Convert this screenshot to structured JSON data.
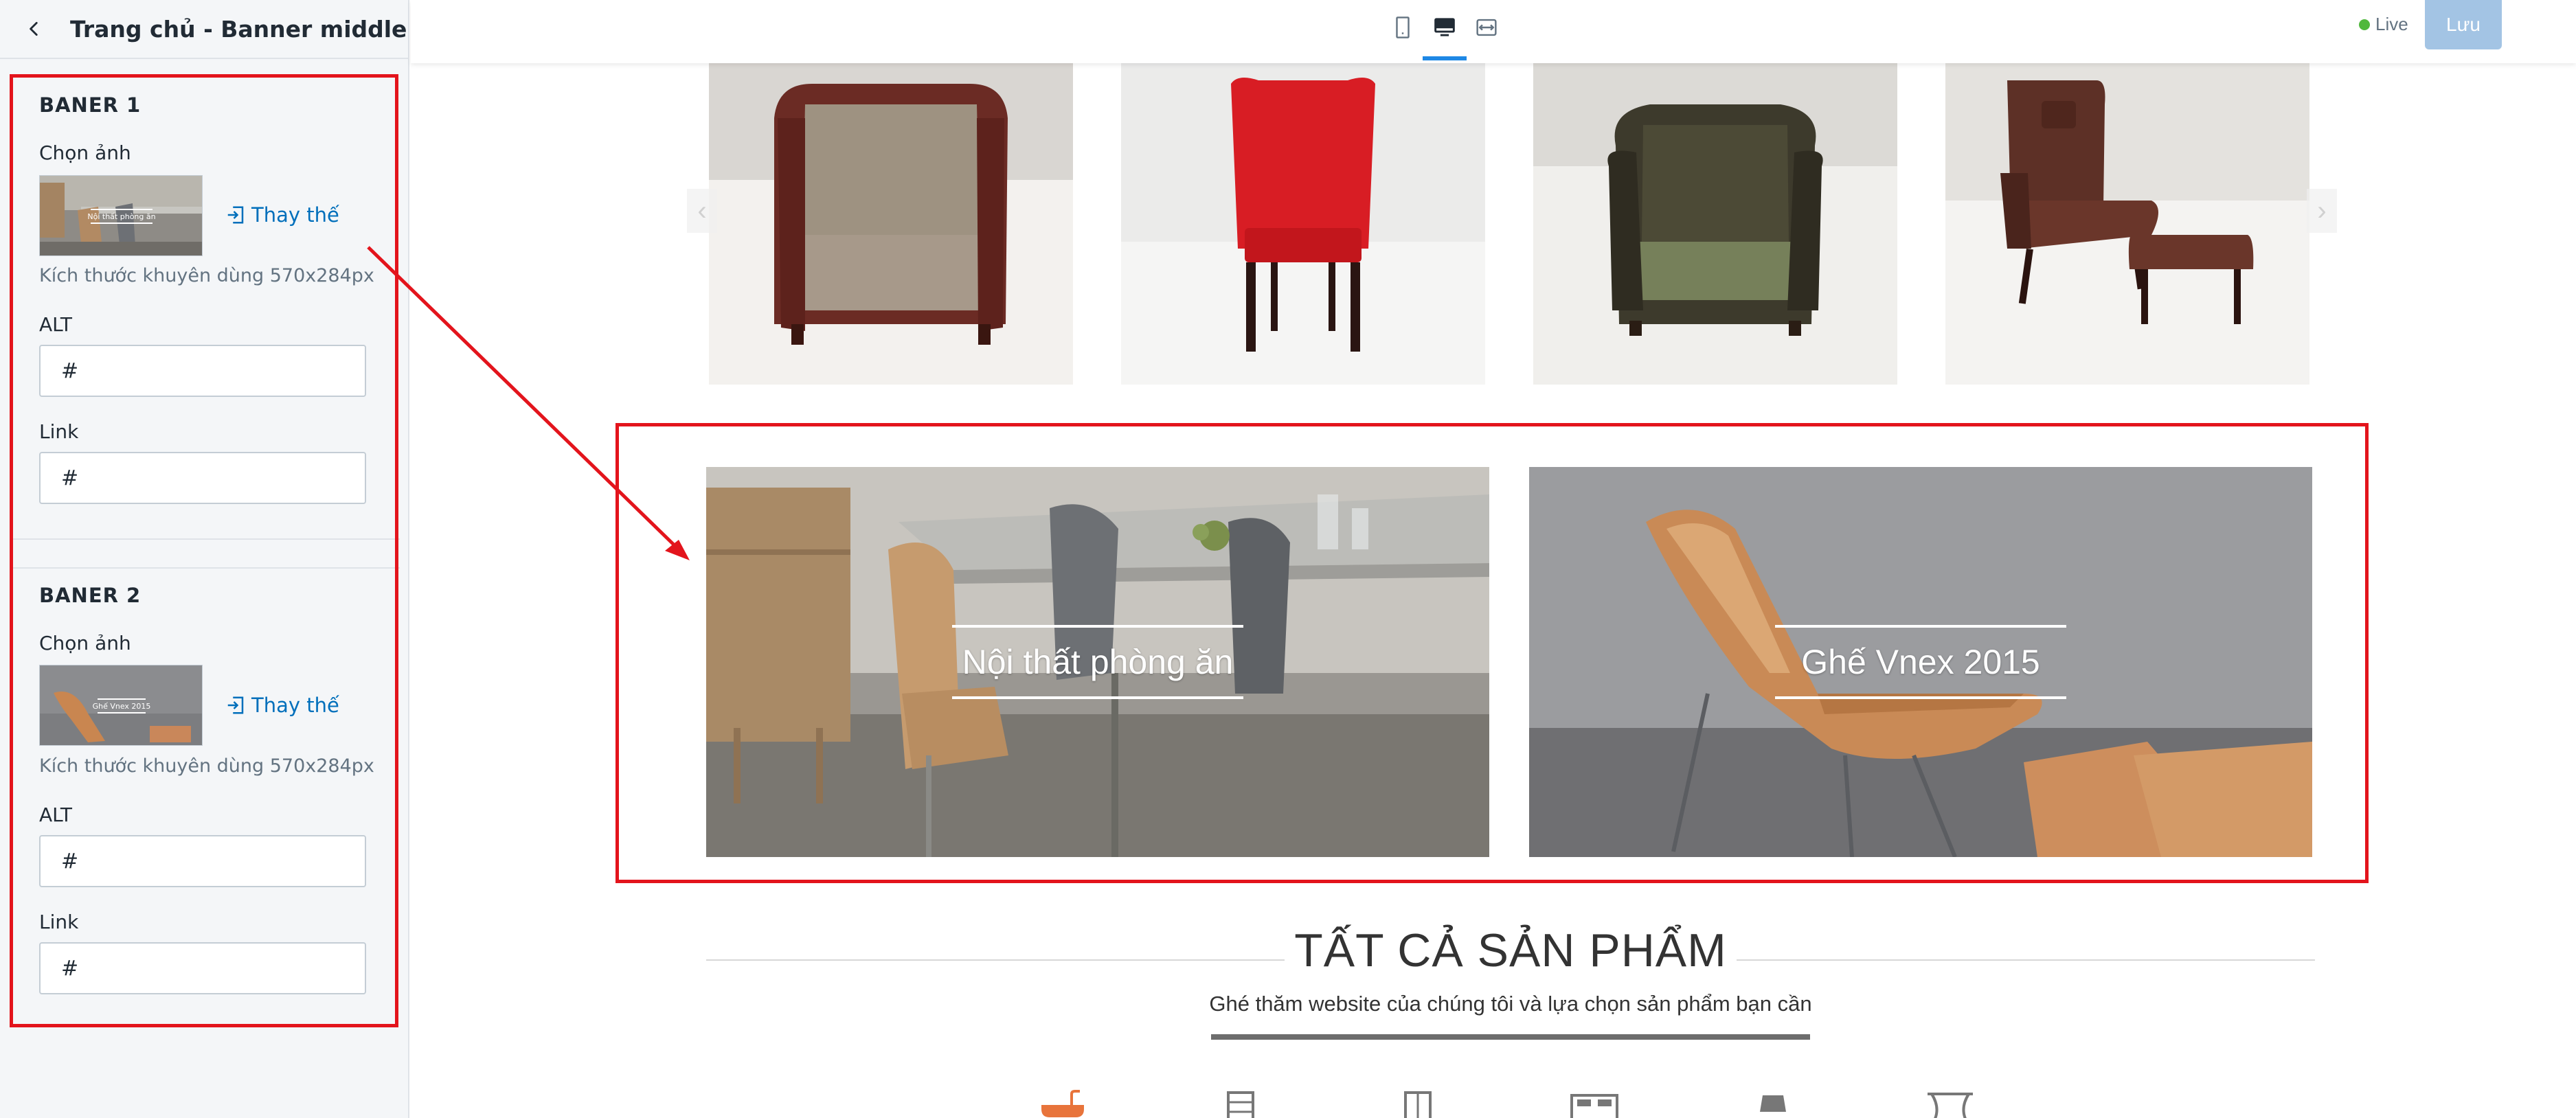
{
  "panel": {
    "title": "Trang chủ - Banner middle",
    "banners": [
      {
        "title": "BANER 1",
        "choose_image_label": "Chọn ảnh",
        "replace_label": "Thay thế",
        "size_hint": "Kích thước khuyên dùng 570x284px",
        "alt_label": "ALT",
        "alt_value": "#",
        "link_label": "Link",
        "link_value": "#"
      },
      {
        "title": "BANER 2",
        "choose_image_label": "Chọn ảnh",
        "replace_label": "Thay thế",
        "size_hint": "Kích thước khuyên dùng 570x284px",
        "alt_label": "ALT",
        "alt_value": "#",
        "link_label": "Link",
        "link_value": "#"
      }
    ]
  },
  "topbar": {
    "live_label": "Live",
    "save_label": "Lưu",
    "devices": [
      "mobile-icon",
      "desktop-icon",
      "fullwidth-icon"
    ],
    "active_device": "desktop"
  },
  "preview": {
    "products": [
      "armchair-leather-studded",
      "red-wingback-chair",
      "green-leather-armchair",
      "brown-lounge-chair-ottoman"
    ],
    "banners": [
      {
        "caption": "Nội thất phòng ăn"
      },
      {
        "caption": "Ghế Vnex 2015"
      }
    ],
    "section_heading": "TẤT CẢ SẢN PHẨM",
    "section_subtitle": "Ghé thăm website của chúng tôi và lựa chọn sản phẩm bạn cần",
    "category_icons": [
      "bathtub-icon",
      "bookshelf-icon",
      "wardrobe-icon",
      "bed-icon",
      "lamp-icon",
      "curtain-icon"
    ]
  },
  "colors": {
    "accent": "#006fbb",
    "annotation_red": "#e3141c",
    "save_button": "#a3c4e4",
    "live_dot": "#50b83c",
    "device_underline": "#1e88e5"
  }
}
